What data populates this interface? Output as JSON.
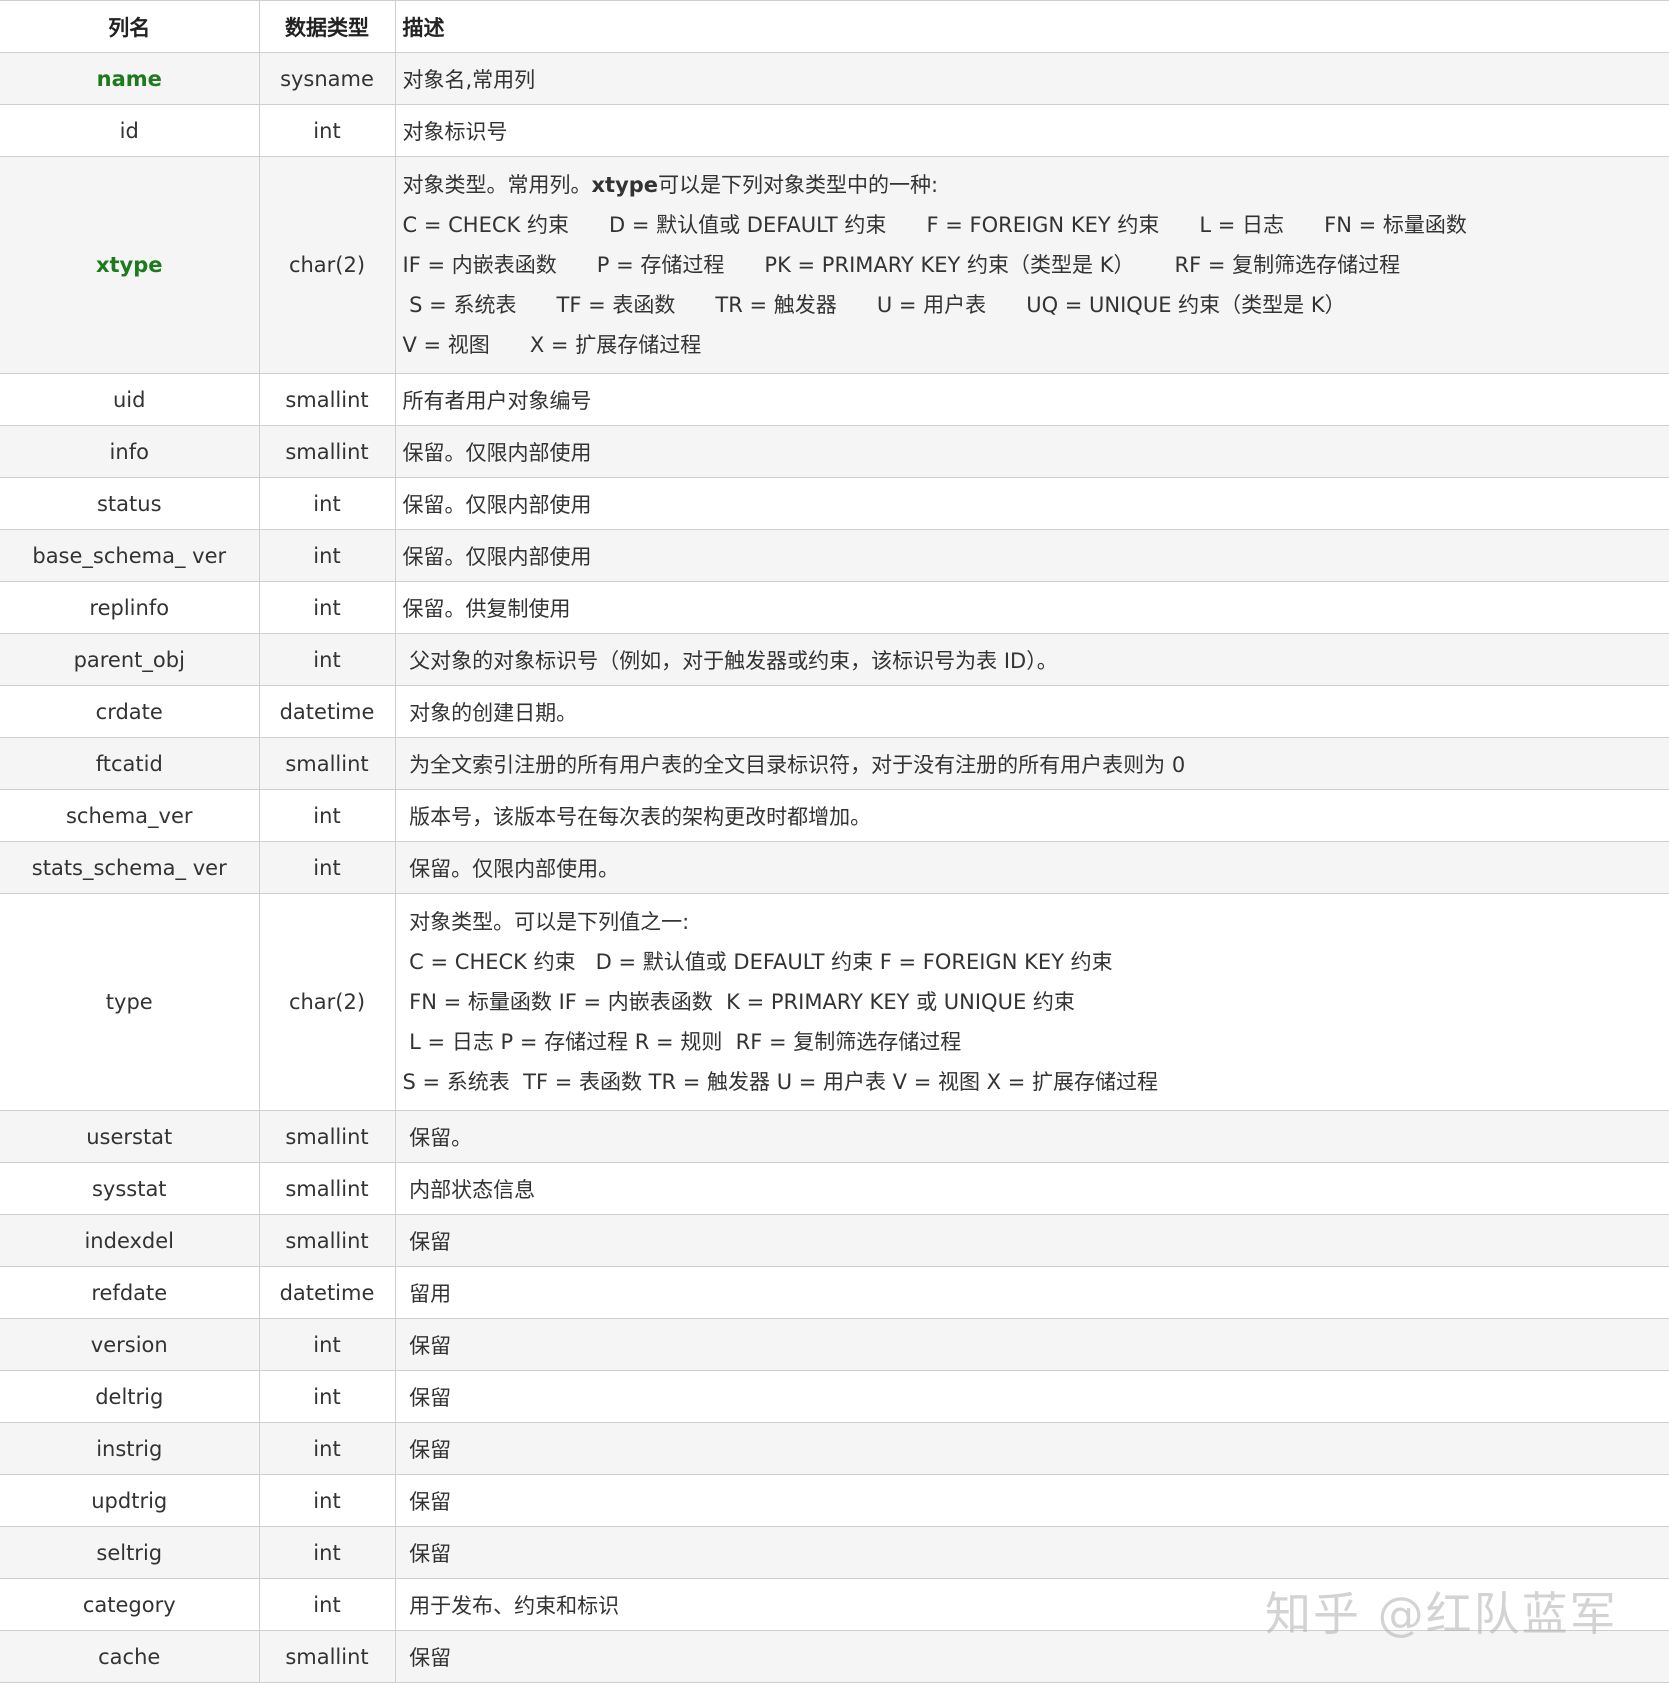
{
  "headers": [
    "列名",
    "数据类型",
    "描述"
  ],
  "rows": [
    {
      "name": "name",
      "type": "sysname",
      "desc": "对象名,常用列"
    },
    {
      "name": "id",
      "type": "int",
      "desc": "对象标识号"
    },
    {
      "name": "xtype",
      "type": "char(2)",
      "desc_lines": [
        {
          "bold": "",
          "pre": "对象类型。常用列。",
          "b": "xtype",
          "post": "可以是下列对象类型中的一种:"
        },
        {
          "text": "C = CHECK 约束      D = 默认值或 DEFAULT 约束      F = FOREIGN KEY 约束      L = 日志      FN = 标量函数"
        },
        {
          "text": "IF = 内嵌表函数      P = 存储过程      PK = PRIMARY KEY 约束（类型是 K）      RF = 复制筛选存储过程"
        },
        {
          "text": " S = 系统表      TF = 表函数      TR = 触发器      U = 用户表      UQ = UNIQUE 约束（类型是 K）"
        },
        {
          "text": "V = 视图      X = 扩展存储过程"
        }
      ]
    },
    {
      "name": "uid",
      "type": "smallint",
      "desc": "所有者用户对象编号"
    },
    {
      "name": "info",
      "type": "smallint",
      "desc": "保留。仅限内部使用"
    },
    {
      "name": "status",
      "type": "int",
      "desc": "保留。仅限内部使用"
    },
    {
      "name": "base_schema_ ver",
      "type": "int",
      "desc": "保留。仅限内部使用"
    },
    {
      "name": "replinfo",
      "type": "int",
      "desc": "保留。供复制使用"
    },
    {
      "name": "parent_obj",
      "type": "int",
      "desc": " 父对象的对象标识号（例如，对于触发器或约束，该标识号为表 ID）。"
    },
    {
      "name": "crdate",
      "type": "datetime",
      "desc": " 对象的创建日期。"
    },
    {
      "name": "ftcatid",
      "type": "smallint",
      "desc": " 为全文索引注册的所有用户表的全文目录标识符，对于没有注册的所有用户表则为 0"
    },
    {
      "name": "schema_ver",
      "type": "int",
      "desc": " 版本号，该版本号在每次表的架构更改时都增加。"
    },
    {
      "name": "stats_schema_ ver",
      "type": "int",
      "desc": " 保留。仅限内部使用。"
    },
    {
      "name": "type",
      "type": "char(2)",
      "desc_lines": [
        {
          "text": " 对象类型。可以是下列值之一:"
        },
        {
          "text": " C = CHECK 约束   D = 默认值或 DEFAULT 约束 F = FOREIGN KEY 约束"
        },
        {
          "text": " FN = 标量函数 IF = 内嵌表函数  K = PRIMARY KEY 或 UNIQUE 约束"
        },
        {
          "text": " L = 日志 P = 存储过程 R = 规则  RF = 复制筛选存储过程"
        },
        {
          "text": "S = 系统表  TF = 表函数 TR = 触发器 U = 用户表 V = 视图 X = 扩展存储过程"
        }
      ]
    },
    {
      "name": "userstat",
      "type": "smallint",
      "desc": " 保留。"
    },
    {
      "name": "sysstat",
      "type": "smallint",
      "desc": " 内部状态信息"
    },
    {
      "name": "indexdel",
      "type": "smallint",
      "desc": " 保留"
    },
    {
      "name": "refdate",
      "type": "datetime",
      "desc": " 留用"
    },
    {
      "name": "version",
      "type": "int",
      "desc": " 保留"
    },
    {
      "name": "deltrig",
      "type": "int",
      "desc": " 保留"
    },
    {
      "name": "instrig",
      "type": "int",
      "desc": " 保留"
    },
    {
      "name": "updtrig",
      "type": "int",
      "desc": " 保留"
    },
    {
      "name": "seltrig",
      "type": "int",
      "desc": " 保留"
    },
    {
      "name": "category",
      "type": "int",
      "desc": " 用于发布、约束和标识"
    },
    {
      "name": "cache",
      "type": "smallint",
      "desc": " 保留"
    }
  ],
  "highlight_color": "#1f7a1f",
  "watermark": "知乎 @红队蓝军"
}
